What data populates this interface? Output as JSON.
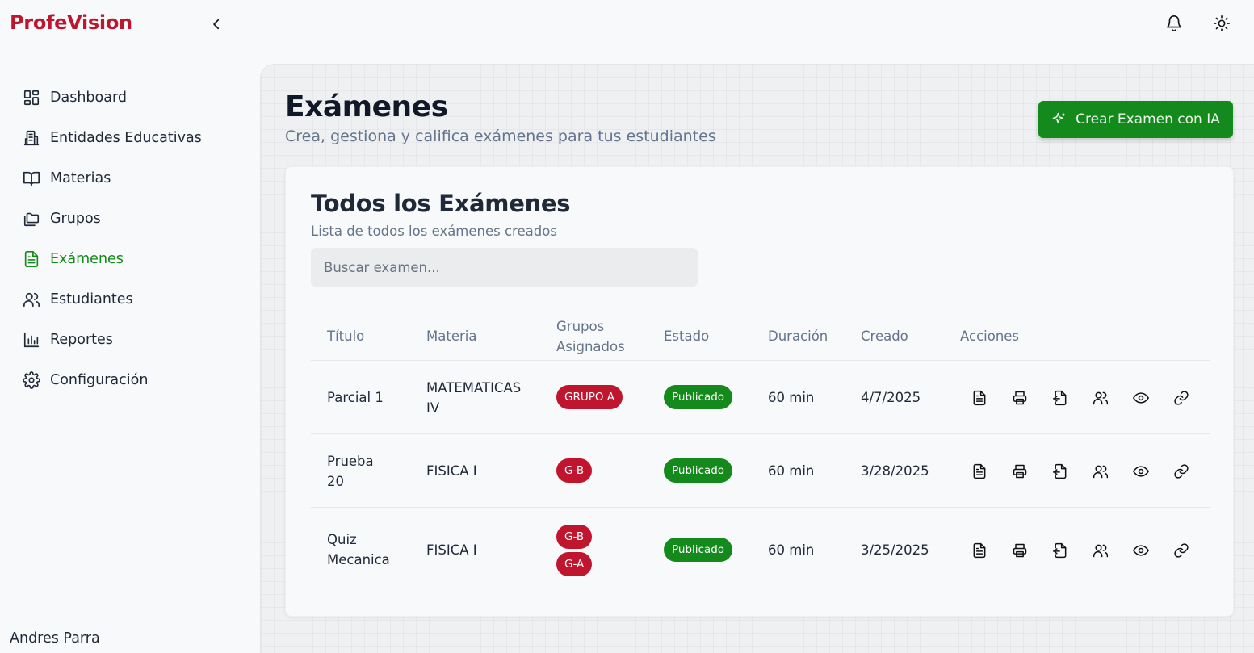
{
  "sidebar": {
    "brand": "ProfeVision",
    "items": [
      {
        "label": "Dashboard",
        "icon": "dashboard-icon"
      },
      {
        "label": "Entidades Educativas",
        "icon": "building-icon"
      },
      {
        "label": "Materias",
        "icon": "book-icon"
      },
      {
        "label": "Grupos",
        "icon": "folders-icon"
      },
      {
        "label": "Exámenes",
        "icon": "file-text-icon",
        "active": true
      },
      {
        "label": "Estudiantes",
        "icon": "users-icon"
      },
      {
        "label": "Reportes",
        "icon": "bar-chart-icon"
      },
      {
        "label": "Configuración",
        "icon": "gear-icon"
      }
    ],
    "user": "Andres Parra"
  },
  "header": {
    "title": "Exámenes",
    "subtitle": "Crea, gestiona y califica exámenes para tus estudiantes",
    "ai_button": "Crear Examen con IA"
  },
  "card": {
    "title": "Todos los Exámenes",
    "subtitle": "Lista de todos los exámenes creados",
    "search_placeholder": "Buscar examen..."
  },
  "table": {
    "columns": [
      "Título",
      "Materia",
      "Grupos Asignados",
      "Estado",
      "Duración",
      "Creado",
      "Acciones"
    ],
    "rows": [
      {
        "titulo": "Parcial 1",
        "materia": "MATEMATICAS IV",
        "grupos": [
          "GRUPO A"
        ],
        "estado": "Publicado",
        "duracion": "60 min",
        "creado": "4/7/2025"
      },
      {
        "titulo": "Prueba 20",
        "materia": "FISICA I",
        "grupos": [
          "G-B"
        ],
        "estado": "Publicado",
        "duracion": "60 min",
        "creado": "3/28/2025"
      },
      {
        "titulo": "Quiz Mecanica",
        "materia": "FISICA I",
        "grupos": [
          "G-B",
          "G-A"
        ],
        "estado": "Publicado",
        "duracion": "60 min",
        "creado": "3/25/2025"
      }
    ],
    "action_icons": [
      "file-text-icon",
      "printer-icon",
      "file-import-icon",
      "users-icon",
      "eye-icon",
      "link-icon"
    ]
  },
  "colors": {
    "brand": "#c0152f",
    "accent_green": "#148a1c",
    "badge_red": "#c0152f"
  }
}
